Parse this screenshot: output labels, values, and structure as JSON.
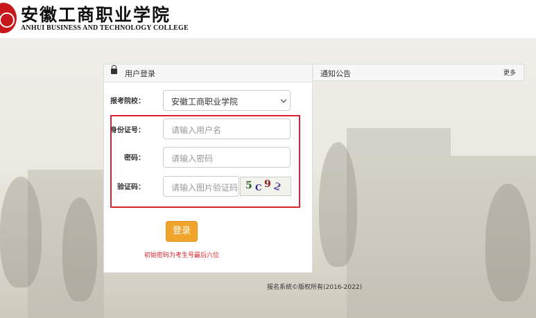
{
  "header": {
    "logo_cn": "安徽工商职业学院",
    "logo_en": "ANHUI BUSINESS AND TECHNOLOGY COLLEGE"
  },
  "login": {
    "title": "用户登录",
    "school_label": "报考院校：",
    "school_value": "安徽工商职业学院",
    "id_label": "身份证号：",
    "id_placeholder": "请输入用户名",
    "password_label": "密码：",
    "password_placeholder": "请输入密码",
    "captcha_label": "验证码：",
    "captcha_placeholder": "请输入图片验证码",
    "captcha_chars": [
      "5",
      "C",
      "9",
      "2"
    ],
    "button_label": "登录",
    "hint": "初始密码为考生号最后六位"
  },
  "notice": {
    "title": "通知公告",
    "more": "更多"
  },
  "footer": {
    "copyright": "报名系统©版权所有(2016-2022)"
  },
  "colors": {
    "accent_button": "#f0a42b",
    "highlight_red": "#d9232d",
    "logo_red": "#c8161d"
  }
}
